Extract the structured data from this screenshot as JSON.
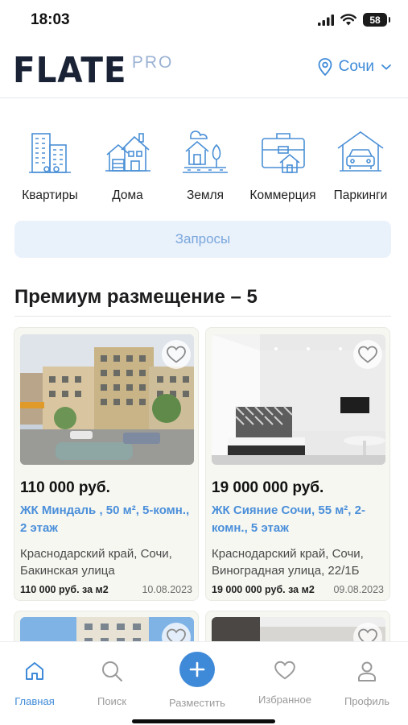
{
  "status_bar": {
    "time": "18:03",
    "battery": "58"
  },
  "header": {
    "logo": "FLATE",
    "logo_suffix": "PRO",
    "city": "Сочи"
  },
  "categories": [
    {
      "label": "Квартиры",
      "icon": "apartments-icon"
    },
    {
      "label": "Дома",
      "icon": "house-icon"
    },
    {
      "label": "Земля",
      "icon": "land-icon"
    },
    {
      "label": "Коммерция",
      "icon": "commerce-icon"
    },
    {
      "label": "Паркинги",
      "icon": "parking-icon"
    }
  ],
  "requests_button": "Запросы",
  "section_title": "Премиум размещение – 5",
  "listings": [
    {
      "price": "110 000 руб.",
      "title": "ЖК Миндаль , 50 м², 5-комн., 2 этаж",
      "address": "Краснодарский край, Сочи, Бакинская улица",
      "price_per_m2": "110 000 руб. за м2",
      "date": "10.08.2023"
    },
    {
      "price": "19 000 000 руб.",
      "title": "ЖК Сияние Сочи, 55 м², 2-комн., 5 этаж",
      "address": "Краснодарский край, Сочи, Виноградная улица, 22/1Б",
      "price_per_m2": "19 000 000 руб. за м2",
      "date": "09.08.2023"
    }
  ],
  "bottom_nav": {
    "home": "Главная",
    "search": "Поиск",
    "add": "Разместить",
    "favorites": "Избранное",
    "profile": "Профиль"
  },
  "colors": {
    "accent": "#3f8ad8",
    "logo": "#1a2235",
    "card_bg": "#f6f7f1",
    "requests_bg": "#e9f1fb"
  }
}
